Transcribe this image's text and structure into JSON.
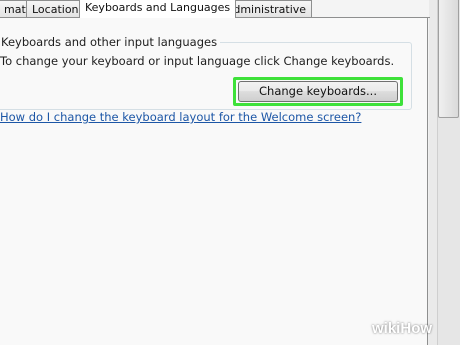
{
  "tabs": [
    {
      "label": "mats"
    },
    {
      "label": "Location"
    },
    {
      "label": "Keyboards and Languages",
      "active": true
    },
    {
      "label": "Administrative"
    }
  ],
  "group": {
    "title": "Keyboards and other input languages",
    "description": "To change your keyboard or input language click Change keyboards."
  },
  "change_keyboards_button": {
    "label": "Change keyboards...",
    "highlight_color": "#3ee13a"
  },
  "help_link": {
    "text": "How do I change the keyboard layout for the Welcome screen?"
  },
  "watermark": {
    "wiki": "wiki",
    "how": "How"
  }
}
